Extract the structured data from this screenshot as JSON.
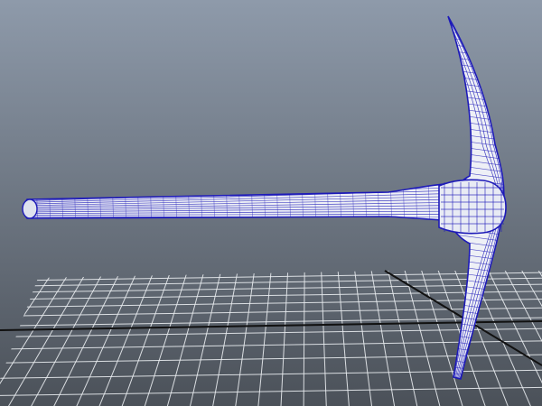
{
  "viewport": {
    "panel": "perspective-viewport",
    "background": {
      "top": "#8e9aaa",
      "bottom": "#4b5159"
    },
    "grid": {
      "visible": true,
      "line_color": "#e9ecef",
      "axis_color": "#111111"
    },
    "wireframe": {
      "object": "pickaxe",
      "edge_color": "#1d1ab8",
      "fill_color": "#eef0f6"
    }
  }
}
